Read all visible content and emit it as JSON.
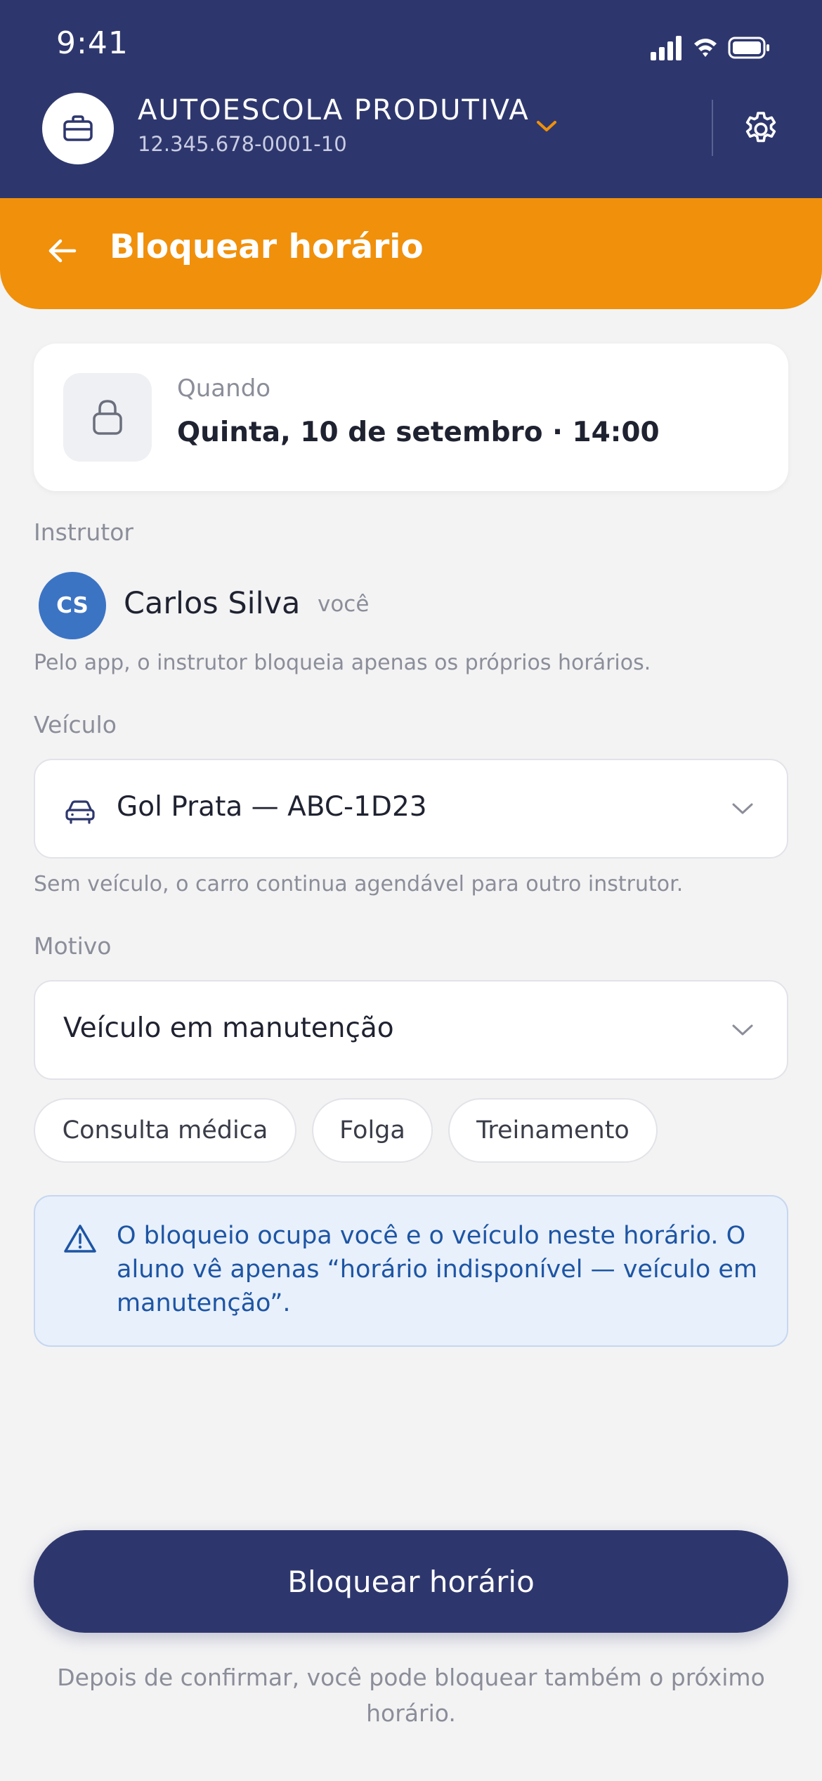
{
  "status_bar": {
    "time": "9:41"
  },
  "organization": {
    "name": "AUTOESCOLA PRODUTIVA",
    "cnpj": "12.345.678-0001-10",
    "icon": "briefcase-icon"
  },
  "title_bar": {
    "title": "Bloquear horário"
  },
  "when": {
    "label": "Quando",
    "value": "Quinta, 10 de setembro · 14:00",
    "icon": "lock-icon"
  },
  "instructor": {
    "section_label": "Instrutor",
    "initials": "CS",
    "name": "Carlos Silva",
    "you_tag": "você",
    "hint": "Pelo app, o instrutor bloqueia apenas os próprios horários."
  },
  "vehicle": {
    "section_label": "Veículo",
    "selected": "Gol Prata — ABC-1D23",
    "icon": "car-icon",
    "hint": "Sem veículo, o carro continua agendável para outro instrutor."
  },
  "reason": {
    "section_label": "Motivo",
    "selected": "Veículo em manutenção",
    "chips": [
      "Consulta médica",
      "Folga",
      "Treinamento"
    ]
  },
  "info": {
    "icon": "warning-icon",
    "text": "O bloqueio ocupa você e o veículo neste horário. O aluno vê apenas “horário indisponível — veículo em manutenção”."
  },
  "cta": {
    "label": "Bloquear horário"
  },
  "footer_note": "Depois de confirmar, você pode bloquear também o próximo horário.",
  "colors": {
    "header": "#2e376d",
    "accent": "#f0900b",
    "avatar": "#3c74c4",
    "info_text": "#1d55a4",
    "info_bg": "#e8f0fb"
  }
}
